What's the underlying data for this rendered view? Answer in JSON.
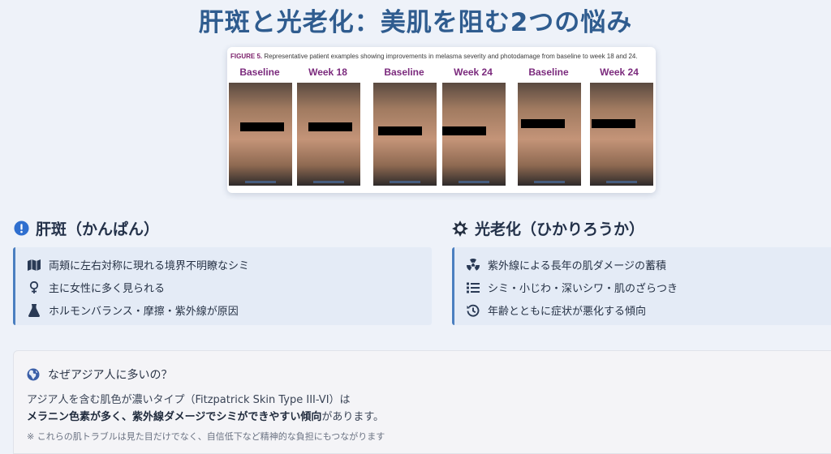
{
  "title": "肝斑と光老化：美肌を阻む2つの悩み",
  "figure": {
    "caption_bold": "FIGURE 5.",
    "caption_text": " Representative patient examples showing improvements in melasma severity and photodamage from baseline to week 18 and 24.",
    "labels": [
      "Baseline",
      "Week 18",
      "Baseline",
      "Week 24",
      "Baseline",
      "Week 24"
    ]
  },
  "melasma": {
    "heading": "肝斑（かんぱん）",
    "icon": "exclamation-circle-icon",
    "items": [
      {
        "icon": "map-icon",
        "text": "両頬に左右対称に現れる境界不明瞭なシミ"
      },
      {
        "icon": "female-icon",
        "text": "主に女性に多く見られる"
      },
      {
        "icon": "flask-icon",
        "text": "ホルモンバランス・摩擦・紫外線が原因"
      }
    ]
  },
  "photoaging": {
    "heading": "光老化（ひかりろうか）",
    "icon": "sun-icon",
    "items": [
      {
        "icon": "radiation-icon",
        "text": "紫外線による長年の肌ダメージの蓄積"
      },
      {
        "icon": "list-icon",
        "text": "シミ・小じわ・深いシワ・肌のざらつき"
      },
      {
        "icon": "history-icon",
        "text": "年齢とともに症状が悪化する傾向"
      }
    ]
  },
  "asia_box": {
    "heading": "なぜアジア人に多いの？",
    "icon": "globe-asia-icon",
    "line1": "アジア人を含む肌色が濃いタイプ（Fitzpatrick Skin Type III-VI）は",
    "line2_bold": "メラニン色素が多く、紫外線ダメージでシミができやすい傾向",
    "line2_rest": "があります。",
    "note": "※ これらの肌トラブルは見た目だけでなく、自信低下など精神的な負担にもつながります"
  },
  "colors": {
    "title": "#2f5c8f",
    "accent": "#4b7fc0",
    "figure_label": "#7b2a7d"
  }
}
